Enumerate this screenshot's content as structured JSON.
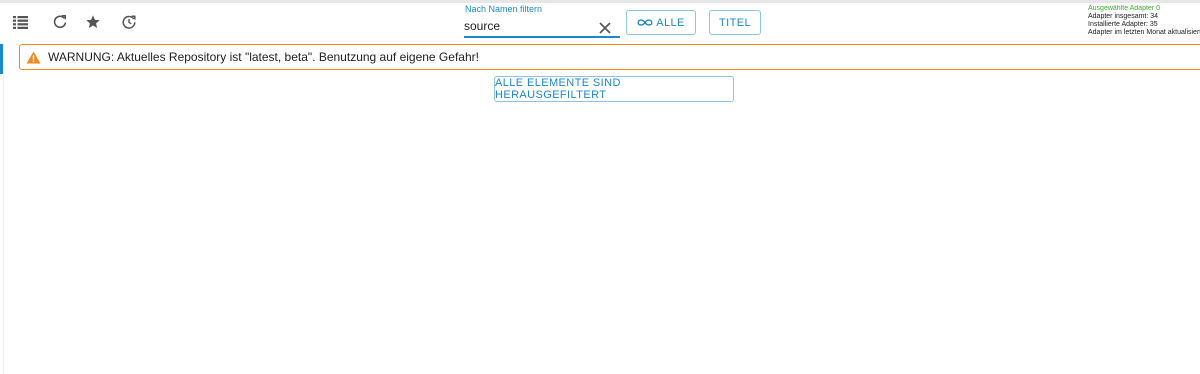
{
  "toolbar": {
    "icons": [
      "list-view-icon",
      "refresh-icon",
      "star-icon",
      "update-icon"
    ]
  },
  "filter": {
    "label": "Nach Namen filtern",
    "value": "source"
  },
  "buttons": {
    "all_label": "ALLE",
    "title_label": "TITEL"
  },
  "stats": {
    "selected": "Ausgewählte Adapter 0",
    "total": "Adapter insgesamt: 34",
    "installed": "Installierte Adapter: 35",
    "last_month": "Adapter im letzten Monat aktualisiert"
  },
  "warning": {
    "text": "WARNUNG: Aktuelles Repository ist \"latest, beta\". Benutzung auf eigene Gefahr!"
  },
  "empty_state": {
    "label": "ALLE ELEMENTE SIND HERAUSGEFILTERT"
  },
  "colors": {
    "accent": "#1e88c8",
    "warning": "#f08a24",
    "selected_green": "#3cb02a"
  }
}
